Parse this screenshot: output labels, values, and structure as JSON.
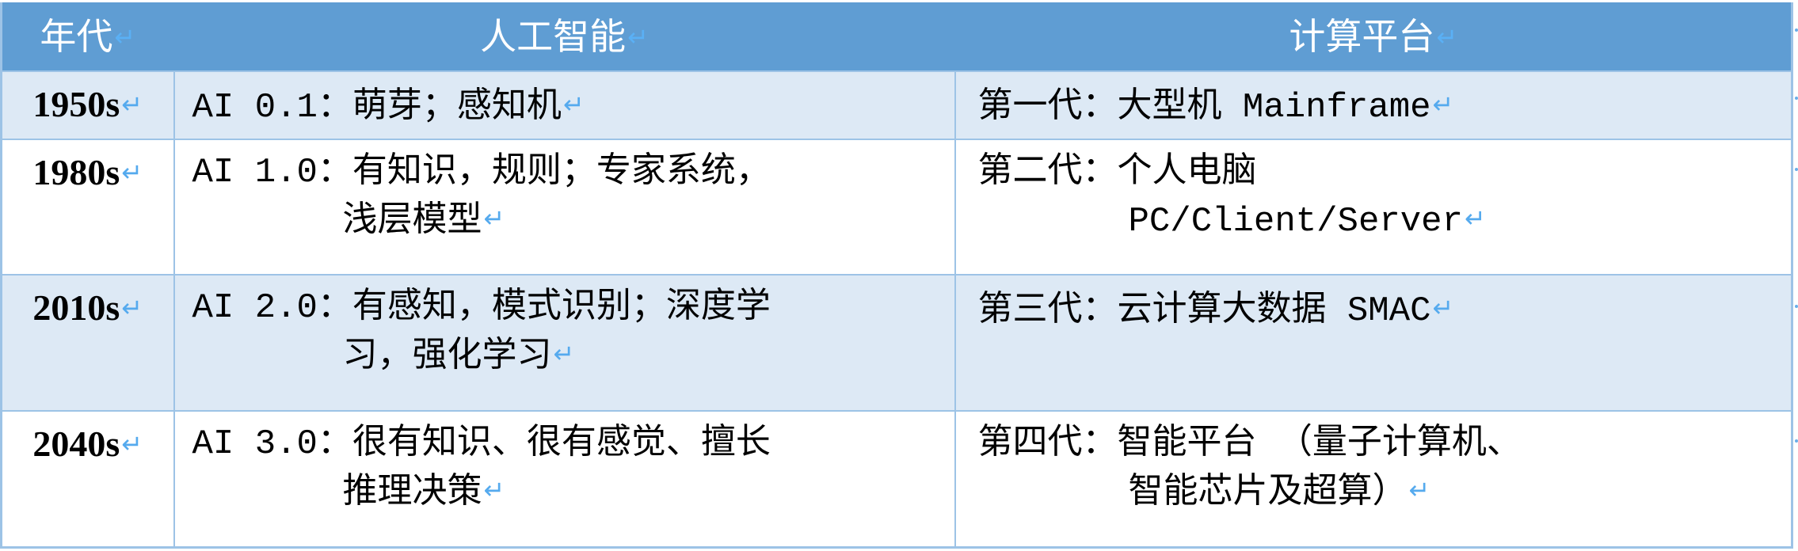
{
  "table": {
    "headers": [
      {
        "label": "年代"
      },
      {
        "label": "人工智能"
      },
      {
        "label": "计算平台"
      }
    ],
    "rows": [
      {
        "era": "1950s",
        "ai": [
          "AI 0.1：萌芽；感知机"
        ],
        "platform": [
          "第一代：大型机 Mainframe"
        ]
      },
      {
        "era": "1980s",
        "ai": [
          "AI 1.0：有知识，规则；专家系统，",
          "浅层模型"
        ],
        "platform": [
          "第二代：个人电脑",
          "PC/Client/Server"
        ]
      },
      {
        "era": "2010s",
        "ai": [
          "AI 2.0：有感知，模式识别；深度学",
          "习，强化学习"
        ],
        "platform": [
          "第三代：云计算大数据 SMAC"
        ]
      },
      {
        "era": "2040s",
        "ai": [
          "AI 3.0：很有知识、很有感觉、擅长",
          "推理决策"
        ],
        "platform": [
          "第四代：智能平台 （量子计算机、",
          "智能芯片及超算）"
        ]
      }
    ],
    "paragraph_mark": "↵"
  },
  "colors": {
    "header_bg": "#5f9dd3",
    "band_bg": "#dde9f5",
    "border": "#9dc3e6",
    "paragraph_mark": "#55aaee"
  }
}
